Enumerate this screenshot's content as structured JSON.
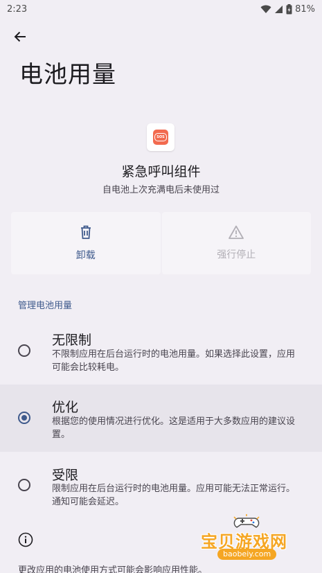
{
  "status_bar": {
    "time": "2:23",
    "battery": "81%"
  },
  "page": {
    "title": "电池用量"
  },
  "app": {
    "name": "紧急呼叫组件",
    "subtitle": "自电池上次充满电后未使用过",
    "icon_text": "SOS",
    "icon_color": "#f26a4f"
  },
  "actions": {
    "uninstall": "卸载",
    "force_stop": "强行停止"
  },
  "section": {
    "header": "管理电池用量"
  },
  "options": [
    {
      "title": "无限制",
      "desc": "不限制应用在后台运行时的电池用量。如果选择此设置，应用可能会比较耗电。",
      "selected": false
    },
    {
      "title": "优化",
      "desc": "根据您的使用情况进行优化。这是适用于大多数应用的建议设置。",
      "selected": true
    },
    {
      "title": "受限",
      "desc": "限制应用在后台运行时的电池用量。应用可能无法正常运行。通知可能会延迟。",
      "selected": false
    }
  ],
  "footer": {
    "text": "更改应用的电池使用方式可能会影响应用性能。"
  },
  "watermark": {
    "name": "宝贝游戏网",
    "url": "baobeiy.com"
  },
  "colors": {
    "accent": "#3f5a8c",
    "background": "#f1eef4",
    "selected_row": "#e7e4eb",
    "watermark": "#f5a623"
  }
}
